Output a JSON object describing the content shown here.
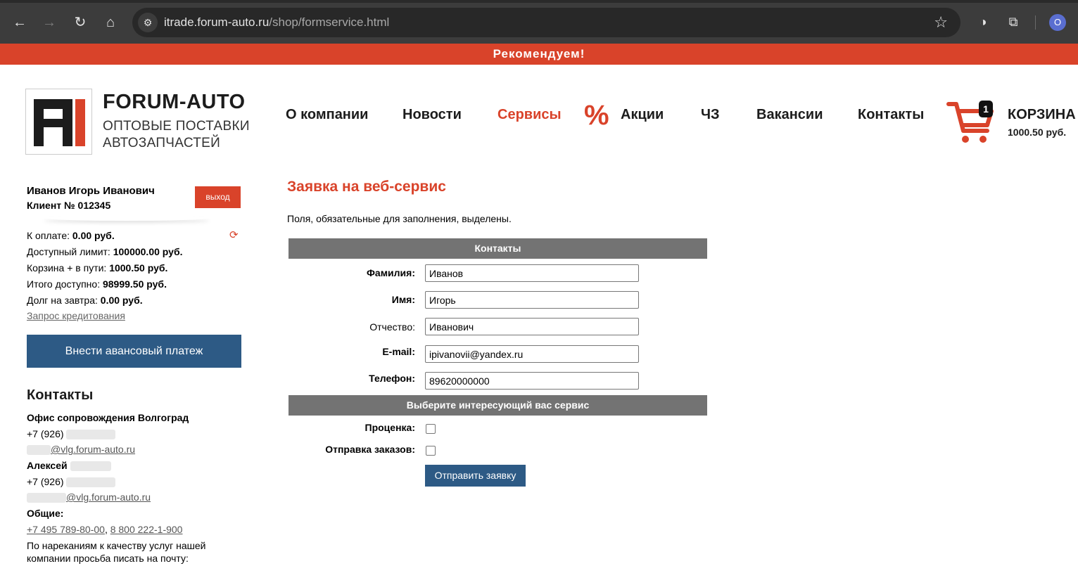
{
  "browser": {
    "url_host": "itrade.forum-auto.ru",
    "url_path": "/shop/formservice.html",
    "profile_initial": "O"
  },
  "promo": {
    "text": "Рекомендуем!"
  },
  "header": {
    "logo_title": "FORUM-AUTO",
    "logo_sub_1": "ОПТОВЫЕ ПОСТАВКИ",
    "logo_sub_2": "АВТОЗАПЧАСТЕЙ",
    "nav": [
      "О компании",
      "Новости",
      "Сервисы",
      "Акции",
      "ЧЗ",
      "Вакансии",
      "Контакты"
    ],
    "active_nav": "Сервисы",
    "cart": {
      "count": "1",
      "title": "КОРЗИНА",
      "sum": "1000.50 руб."
    }
  },
  "sidebar": {
    "user_name": "Иванов Игорь Иванович",
    "client": "Клиент № 012345",
    "logout": "выход",
    "balances": [
      {
        "label": "К оплате: ",
        "value": "0.00 руб."
      },
      {
        "label": "Доступный лимит: ",
        "value": "100000.00 руб."
      },
      {
        "label": "Корзина + в пути: ",
        "value": "1000.50 руб."
      },
      {
        "label": "Итого доступно: ",
        "value": "98999.50 руб."
      },
      {
        "label": "Долг на завтра: ",
        "value": "0.00 руб."
      }
    ],
    "credit_link": "Запрос кредитования",
    "advance_button": "Внести авансовый платеж",
    "contacts_title": "Контакты",
    "office": "Офис сопровождения Волгоград",
    "office_phone": "+7 (926)",
    "office_email": "@vlg.forum-auto.ru",
    "person": "Алексей",
    "person_phone": "+7 (926)",
    "person_email": "@vlg.forum-auto.ru",
    "general_label": "Общие:",
    "general_phone_1": "+7 495 789-80-00",
    "general_sep": ",",
    "general_phone_2": "8 800 222-1-900",
    "complaint_1": "По нареканиям к качеству услуг нашей",
    "complaint_2": "компании просьба писать на почту:"
  },
  "form": {
    "title": "Заявка на веб-сервис",
    "note": "Поля, обязательные для заполнения, выделены.",
    "section_contacts": "Контакты",
    "fields": [
      {
        "label": "Фамилия:",
        "value": "Иванов",
        "required": true
      },
      {
        "label": "Имя:",
        "value": "Игорь",
        "required": true
      },
      {
        "label": "Отчество:",
        "value": "Иванович",
        "required": false
      },
      {
        "label": "E-mail:",
        "value": "ipivanovii@yandex.ru",
        "required": true
      },
      {
        "label": "Телефон:",
        "value": "89620000000",
        "required": true
      }
    ],
    "section_services": "Выберите интересующий вас сервис",
    "services": [
      {
        "label": "Проценка:",
        "checked": false
      },
      {
        "label": "Отправка заказов:",
        "checked": false
      }
    ],
    "submit": "Отправить заявку"
  },
  "colors": {
    "brand_red": "#d9432a",
    "button_blue": "#2d5a85",
    "section_gray": "#737373"
  }
}
